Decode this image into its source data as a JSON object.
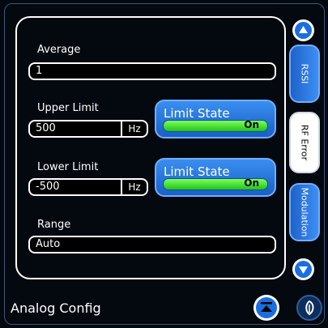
{
  "average": {
    "label": "Average",
    "value": "1"
  },
  "upper_limit": {
    "label": "Upper Limit",
    "value": "500",
    "unit": "Hz"
  },
  "lower_limit": {
    "label": "Lower Limit",
    "value": "-500",
    "unit": "Hz"
  },
  "range": {
    "label": "Range",
    "value": "Auto"
  },
  "limit_state_upper": {
    "label": "Limit State",
    "state": "On"
  },
  "limit_state_lower": {
    "label": "Limit State",
    "state": "On"
  },
  "tabs": [
    {
      "label": "RSSI",
      "active": false
    },
    {
      "label": "RF Error",
      "active": true
    },
    {
      "label": "Modulation",
      "active": false
    }
  ],
  "footer": {
    "title": "Analog Config"
  },
  "icons": {
    "scroll_up": "chevron-up-icon",
    "scroll_down": "chevron-down-icon",
    "collapse": "eject-icon",
    "help": "leaf-icon"
  },
  "colors": {
    "accent": "#1a6fe0",
    "on_state": "#3fe02b",
    "background": "#04080f"
  }
}
